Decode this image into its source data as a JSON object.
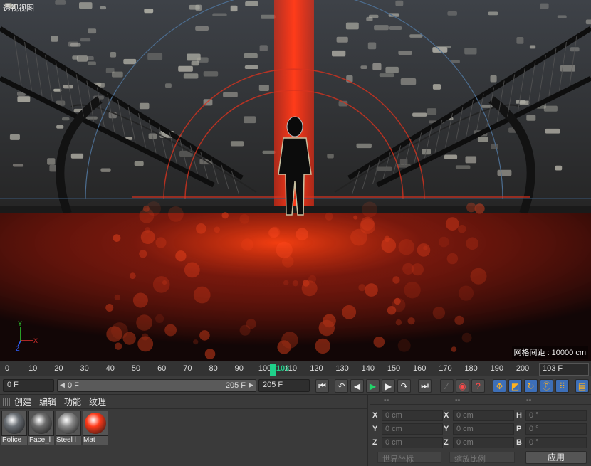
{
  "viewport": {
    "title": "透视视图",
    "grid_spacing": "网格间距 : 10000 cm"
  },
  "timeline": {
    "ticks": [
      "0",
      "10",
      "20",
      "30",
      "40",
      "50",
      "60",
      "70",
      "80",
      "90",
      "100",
      "110",
      "120",
      "130",
      "140",
      "150",
      "160",
      "170",
      "180",
      "190",
      "200"
    ],
    "current_frame": 103,
    "playhead_label": "103",
    "current_frame_field": "103 F"
  },
  "transport": {
    "start_field": "0 F",
    "range_start": "0 F",
    "range_end": "205 F",
    "end_field": "205 F",
    "buttons": [
      "go-start",
      "prev-key",
      "prev-frame",
      "play",
      "next-frame",
      "next-key",
      "go-end",
      "record-disabled",
      "record-auto",
      "record-help",
      "move",
      "scale",
      "rotate",
      "param",
      "grid-points",
      "film"
    ]
  },
  "materials": {
    "menu": [
      "创建",
      "编辑",
      "功能",
      "纹理"
    ],
    "items": [
      {
        "name": "Police",
        "color": "#6a6f75"
      },
      {
        "name": "Face_l",
        "color": "#6c6c6c"
      },
      {
        "name": "Steel l",
        "color": "#8a8a8a"
      },
      {
        "name": "Mat",
        "color": "#ff3a1a"
      }
    ]
  },
  "coordinates": {
    "header": [
      "--",
      "--",
      "--"
    ],
    "rows": [
      {
        "l1": "X",
        "v1": "0 cm",
        "l2": "X",
        "v2": "0 cm",
        "l3": "H",
        "v3": "0 °"
      },
      {
        "l1": "Y",
        "v1": "0 cm",
        "l2": "Y",
        "v2": "0 cm",
        "l3": "P",
        "v3": "0 °"
      },
      {
        "l1": "Z",
        "v1": "0 cm",
        "l2": "Z",
        "v2": "0 cm",
        "l3": "B",
        "v3": "0 °"
      }
    ],
    "world_coords": "世界坐标",
    "scale_ratio": "缩放比例",
    "apply": "应用"
  },
  "axis": {
    "x": "X",
    "y": "Y",
    "z": "Z"
  },
  "colors": {
    "accent": "#1fd08a",
    "beam": "#ff3a1a"
  }
}
